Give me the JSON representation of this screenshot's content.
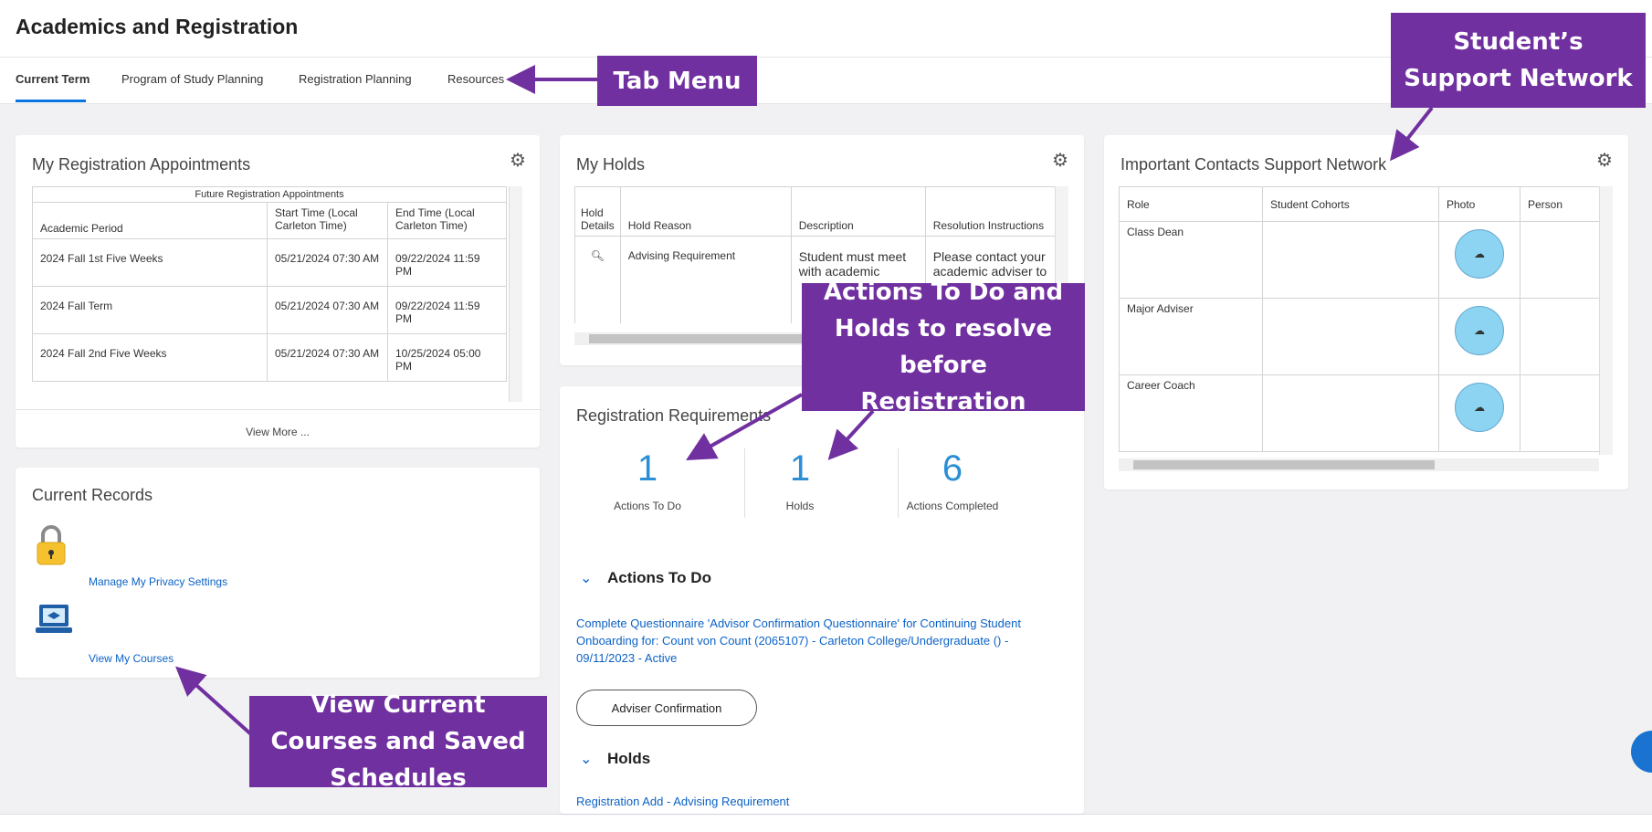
{
  "page": {
    "title": "Academics and Registration"
  },
  "tabs": [
    {
      "label": "Current Term",
      "active": true
    },
    {
      "label": "Program of Study Planning",
      "active": false
    },
    {
      "label": "Registration Planning",
      "active": false
    },
    {
      "label": "Resources",
      "active": false
    }
  ],
  "appointments": {
    "title": "My Registration Appointments",
    "table_caption": "Future Registration Appointments",
    "columns": [
      "Academic Period",
      "Start Time (Local Carleton Time)",
      "End Time (Local Carleton Time)"
    ],
    "rows": [
      {
        "period": "2024 Fall 1st Five Weeks",
        "start": "05/21/2024 07:30 AM",
        "end": "09/22/2024 11:59 PM"
      },
      {
        "period": "2024 Fall Term",
        "start": "05/21/2024 07:30 AM",
        "end": "09/22/2024 11:59 PM"
      },
      {
        "period": "2024 Fall 2nd Five Weeks",
        "start": "05/21/2024 07:30 AM",
        "end": "10/25/2024 05:00 PM"
      }
    ],
    "view_more": "View More ..."
  },
  "records": {
    "title": "Current Records",
    "items": [
      {
        "label": "Manage My Privacy Settings",
        "icon": "padlock-icon"
      },
      {
        "label": "View My Courses",
        "icon": "laptop-course-icon"
      }
    ]
  },
  "holds": {
    "title": "My Holds",
    "columns": [
      "Hold Details",
      "Hold Reason",
      "Description",
      "Resolution Instructions"
    ],
    "row": {
      "reason": "Advising Requirement",
      "description": "Student must meet with academic",
      "resolution": "Please contact your academic adviser to"
    }
  },
  "requirements": {
    "title": "Registration Requirements",
    "stats": [
      {
        "value": "1",
        "label": "Actions To Do"
      },
      {
        "value": "1",
        "label": "Holds"
      },
      {
        "value": "6",
        "label": "Actions Completed"
      }
    ],
    "actions_heading": "Actions To Do",
    "action_link": "Complete Questionnaire 'Advisor Confirmation Questionnaire' for Continuing Student Onboarding for: Count von Count (2065107) - Carleton College/Undergraduate () - 09/11/2023 - Active",
    "action_button": "Adviser Confirmation",
    "holds_heading": "Holds",
    "hold_link": "Registration Add - Advising Requirement"
  },
  "contacts": {
    "title": "Important Contacts Support Network",
    "columns": [
      "Role",
      "Student Cohorts",
      "Photo",
      "Person"
    ],
    "rows": [
      {
        "role": "Class Dean"
      },
      {
        "role": "Major Adviser"
      },
      {
        "role": "Career Coach"
      }
    ]
  },
  "callouts": {
    "tab_menu": "Tab Menu",
    "support_network": "Student’s Support Network",
    "actions_holds": "Actions To Do and Holds to resolve before Registration",
    "view_courses": "View Current Courses and Saved Schedules"
  },
  "colors": {
    "accent": "#0875e1",
    "callout": "#7030a0",
    "link": "#0b62c6",
    "stat": "#2c8fd6"
  }
}
